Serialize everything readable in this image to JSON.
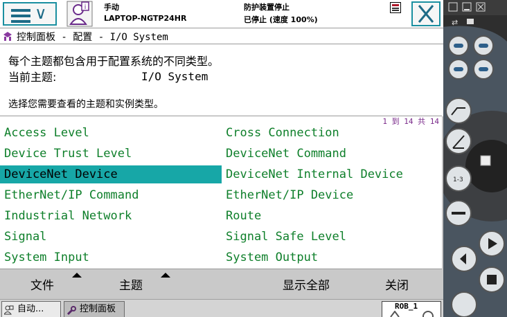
{
  "header": {
    "mode": "手动",
    "host": "LAPTOP-NGTP24HR",
    "guard_status": "防护装置停止",
    "run_status": "已停止 (速度 100%)"
  },
  "title": {
    "breadcrumb": "控制面板 - 配置 - I/O System"
  },
  "info": {
    "description": "每个主题都包含用于配置系统的不同类型。",
    "current_topic_label": "当前主题:",
    "current_topic_value": "I/O System",
    "select_prompt": "选择您需要查看的主题和实例类型。"
  },
  "list": {
    "page_count": "1 到 14 共 14",
    "selected": "DeviceNet Device",
    "left": [
      "Access Level",
      "Device Trust Level",
      "DeviceNet Device",
      "EtherNet/IP Command",
      "Industrial Network",
      "Signal",
      "System Input"
    ],
    "right": [
      "Cross Connection",
      "DeviceNet Command",
      "DeviceNet Internal Device",
      "EtherNet/IP Device",
      "Route",
      "Signal Safe Level",
      "System Output"
    ]
  },
  "commands": {
    "file": "文件",
    "topic": "主题",
    "show_all": "显示全部",
    "close": "关闭"
  },
  "taskbar": {
    "tab_auto": "自动...",
    "tab_control_panel": "控制面板",
    "robot": "ROB_1"
  },
  "colors": {
    "accent": "#17a7a7",
    "list_text": "#0e7f2a",
    "header_border": "#1a8fa0"
  }
}
